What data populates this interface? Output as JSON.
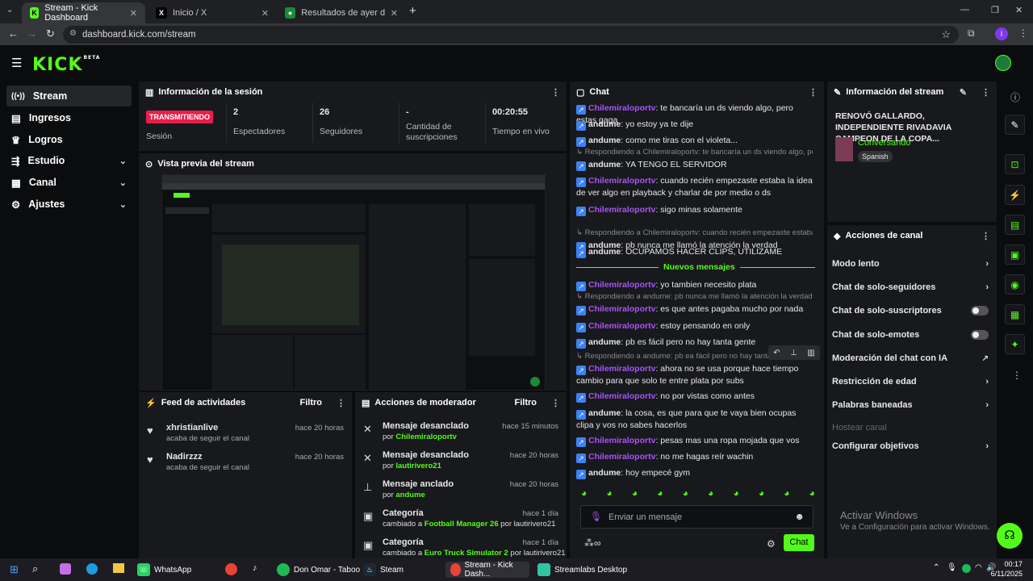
{
  "browser": {
    "tabs": [
      {
        "label": "Stream - Kick Dashboard",
        "active": true
      },
      {
        "label": "Inicio / X",
        "active": false
      },
      {
        "label": "Resultados de ayer del Futbol A",
        "active": false
      }
    ],
    "url": "dashboard.kick.com/stream",
    "profile_initial": "I"
  },
  "header": {
    "logo": "KICK",
    "logo_badge": "BETA"
  },
  "sidebar": {
    "items": [
      {
        "label": "Stream"
      },
      {
        "label": "Ingresos"
      },
      {
        "label": "Logros"
      },
      {
        "label": "Estudio"
      },
      {
        "label": "Canal"
      },
      {
        "label": "Ajustes"
      }
    ]
  },
  "session": {
    "title": "Información de la sesión",
    "status_badge": "TRANSMITIENDO",
    "status_label": "Sesión",
    "stats": [
      {
        "value": "2",
        "label": "Espectadores"
      },
      {
        "value": "26",
        "label": "Seguidores"
      },
      {
        "value": "-",
        "label": "Cantidad de suscripciones"
      },
      {
        "value": "00:20:55",
        "label": "Tiempo en vivo"
      }
    ]
  },
  "preview": {
    "title": "Vista previa del stream"
  },
  "feed": {
    "title": "Feed de actividades",
    "filter": "Filtro",
    "items": [
      {
        "name": "xhristianlive",
        "desc": "acaba de seguir el canal",
        "time": "hace 20 horas"
      },
      {
        "name": "Nadirzzz",
        "desc": "acaba de seguir el canal",
        "time": "hace 20 horas"
      }
    ]
  },
  "modactions": {
    "title": "Acciones de moderador",
    "filter": "Filtro",
    "items": [
      {
        "title": "Mensaje desanclado",
        "pre": "por ",
        "user": "Chilemiraloportv",
        "post": "",
        "time": "hace 15 minutos"
      },
      {
        "title": "Mensaje desanclado",
        "pre": "por ",
        "user": "lautirivero21",
        "post": "",
        "time": "hace 20 horas"
      },
      {
        "title": "Mensaje anclado",
        "pre": "por ",
        "user": "andume",
        "post": "",
        "time": "hace 20 horas"
      },
      {
        "title": "Categoría",
        "pre": "cambiado a ",
        "user": "Football Manager 26",
        "post": " por lautirivero21",
        "time": "hace 1 día"
      },
      {
        "title": "Categoría",
        "pre": "cambiado a ",
        "user": "Euro Truck Simulator 2",
        "post": " por lautirivero21",
        "time": "hace 1 día"
      }
    ]
  },
  "chat": {
    "title": "Chat",
    "new_messages": "Nuevos mensajes",
    "placeholder": "Enviar un mensaje",
    "send": "Chat",
    "messages": [
      {
        "reply": "",
        "user": "Chilemiraloportv",
        "type": "u1",
        "text": ": te bancaría un ds viendo algo, pero estas gaga"
      },
      {
        "reply": "",
        "user": "andume",
        "type": "u2",
        "text": ": yo estoy ya te dije"
      },
      {
        "reply": "",
        "user": "andume",
        "type": "u2",
        "text": ": como me tiras con el violeta..."
      },
      {
        "reply": "Respondiendo a Chilemiraloportv: te bancaría un ds viendo algo, pero ...",
        "user": "andume",
        "type": "u2",
        "text": ": YA TENGO EL SERVIDOR"
      },
      {
        "reply": "",
        "user": "Chilemiraloportv",
        "type": "u1",
        "text": ": cuando recién empezaste estaba la idea de ver algo en playback y charlar de por medio o ds"
      },
      {
        "reply": "",
        "user": "Chilemiraloportv",
        "type": "u1",
        "text": ": sigo minas solamente"
      },
      {
        "reply": "Respondiendo a Chilemiraloportv: cuando recién empezaste estaba la ...",
        "user": "andume",
        "type": "u2",
        "text": ": pb nunca me llamó la atención la verdad"
      },
      {
        "reply": "",
        "user": "andume",
        "type": "u2",
        "text": ": OCUPAMOS HACER CLIPS, UTILIZAME"
      },
      {
        "reply": "",
        "user": "Chilemiraloportv",
        "type": "u1",
        "text": ": yo tambien necesito plata"
      },
      {
        "reply": "Respondiendo a andume: pb nunca me llamó la atención la verdad",
        "user": "Chilemiraloportv",
        "type": "u1",
        "text": ": es que antes pagaba mucho por nada"
      },
      {
        "reply": "",
        "user": "Chilemiraloportv",
        "type": "u1",
        "text": ": estoy pensando en only"
      },
      {
        "reply": "",
        "user": "andume",
        "type": "u2",
        "text": ": pb es fácil pero no hay tanta gente"
      },
      {
        "reply": "Respondiendo a andume: pb ea fácil pero no hay tanta gente",
        "user": "Chilemiraloportv",
        "type": "u1",
        "text": ": ahora no se usa porque hace tiempo cambio para que solo te entre plata por subs"
      },
      {
        "reply": "",
        "user": "Chilemiraloportv",
        "type": "u1",
        "text": ": no por vistas como antes"
      },
      {
        "reply": "",
        "user": "andume",
        "type": "u2",
        "text": ": la cosa, es que para que te vaya bien ocupas clipa y vos no sabes hacerlos"
      },
      {
        "reply": "",
        "user": "Chilemiraloportv",
        "type": "u1",
        "text": ": pesas mas una ropa mojada que vos"
      },
      {
        "reply": "",
        "user": "Chilemiraloportv",
        "type": "u1",
        "text": ": no me hagas reír wachin"
      },
      {
        "reply": "",
        "user": "andume",
        "type": "u2",
        "text": ": hoy empecé gym"
      }
    ]
  },
  "streaminfo": {
    "title": "Información del stream",
    "stream_title": "RENOVÓ GALLARDO, INDEPENDIENTE RIVADAVIA CAMPEON DE LA COPA...",
    "category": "Conversando",
    "language": "Spanish"
  },
  "channel_actions": {
    "title": "Acciones de canal",
    "items": [
      {
        "label": "Modo lento",
        "control": "chevron"
      },
      {
        "label": "Chat de solo-seguidores",
        "control": "chevron"
      },
      {
        "label": "Chat de solo-suscriptores",
        "control": "toggle"
      },
      {
        "label": "Chat de solo-emotes",
        "control": "toggle"
      },
      {
        "label": "Moderación del chat con IA",
        "control": "link"
      },
      {
        "label": "Restricción de edad",
        "control": "chevron"
      },
      {
        "label": "Palabras baneadas",
        "control": "chevron"
      },
      {
        "label": "Hostear canal",
        "control": "none"
      },
      {
        "label": "Configurar objetivos",
        "control": "chevron"
      }
    ]
  },
  "watermark": {
    "line1": "Activar Windows",
    "line2": "Ve a Configuración para activar Windows."
  },
  "taskbar": {
    "apps": [
      {
        "label": "WhatsApp"
      },
      {
        "label": "Don Omar - Taboo"
      },
      {
        "label": "Steam"
      },
      {
        "label": "Stream - Kick Dash..."
      },
      {
        "label": "Streamlabs Desktop"
      }
    ],
    "time": "00:17",
    "date": "6/11/2025"
  },
  "colors": {
    "accent": "#53fc18",
    "live": "#e91e4a",
    "user_purple": "#a855f7"
  }
}
